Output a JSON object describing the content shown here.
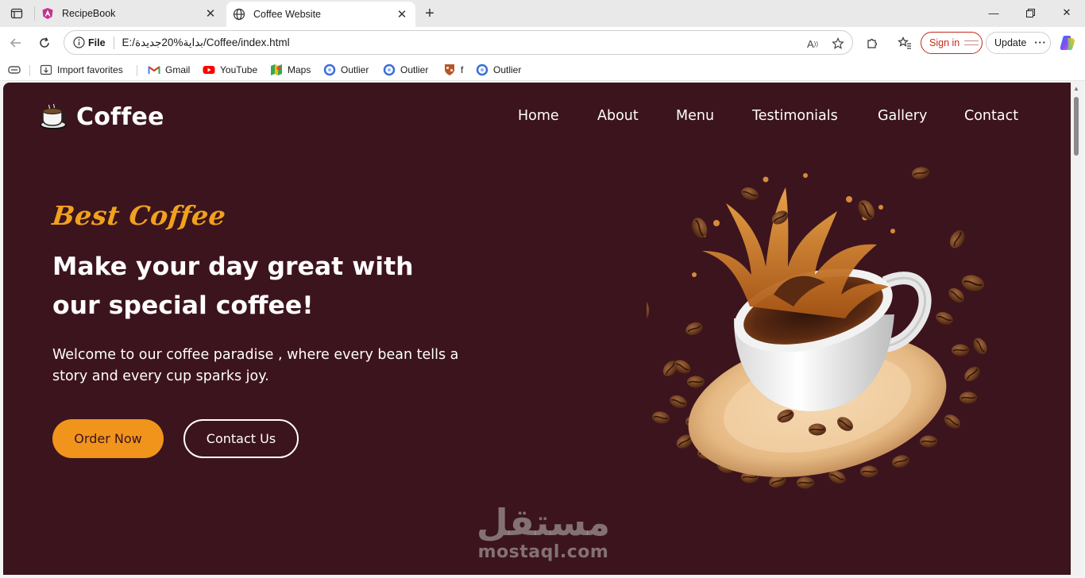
{
  "browser": {
    "tabs": [
      {
        "title": "RecipeBook",
        "active": false
      },
      {
        "title": "Coffee Website",
        "active": true
      }
    ],
    "address": {
      "scheme_label": "File",
      "url": "E:/بداية%20جديدة/Coffee/index.html"
    },
    "signin_label": "Sign in",
    "update_label": "Update",
    "bookmarks": [
      {
        "label": "Import favorites",
        "icon": "import-icon"
      },
      {
        "label": "Gmail",
        "icon": "gmail-icon"
      },
      {
        "label": "YouTube",
        "icon": "youtube-icon"
      },
      {
        "label": "Maps",
        "icon": "maps-icon"
      },
      {
        "label": "Outlier",
        "icon": "outlier-icon"
      },
      {
        "label": "Outlier",
        "icon": "outlier-icon"
      },
      {
        "label": "f",
        "icon": "shield-icon"
      },
      {
        "label": "Outlier",
        "icon": "outlier-icon"
      }
    ]
  },
  "site": {
    "logo_text": "Coffee",
    "nav": [
      "Home",
      "About",
      "Menu",
      "Testimonials",
      "Gallery",
      "Contact"
    ],
    "hero": {
      "kicker": "Best Coffee",
      "title": "Make your day great with our special coffee!",
      "description": "Welcome to our coffee paradise , where every bean tells a story and every cup sparks joy.",
      "primary_button": "Order Now",
      "secondary_button": "Contact Us"
    },
    "colors": {
      "background": "#3c141d",
      "accent": "#f0941c",
      "text": "#ffffff"
    }
  },
  "watermark": {
    "arabic": "مستقل",
    "latin": "mostaql.com"
  }
}
